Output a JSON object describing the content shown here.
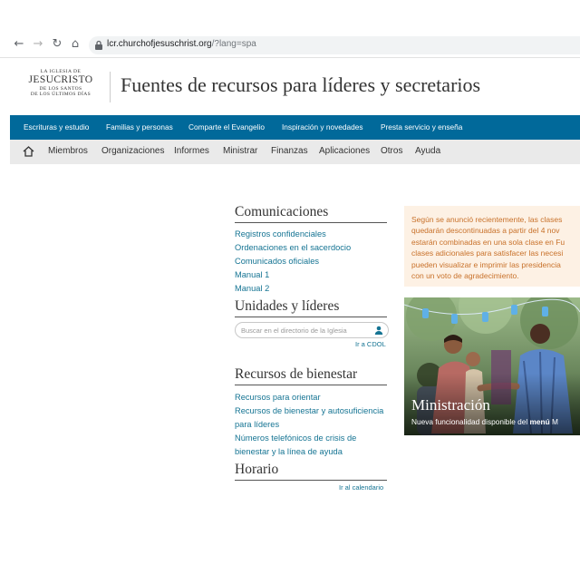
{
  "browser": {
    "url_host": "lcr.churchofjesuschrist.org",
    "url_path": "/?lang=spa"
  },
  "logo": {
    "line1": "LA IGLESIA DE",
    "line2": "JESUCRISTO",
    "line3": "DE LOS SANTOS",
    "line4": "DE LOS ÚLTIMOS DÍAS"
  },
  "header": {
    "title": "Fuentes de recursos para líderes y secretarios"
  },
  "primary_nav": [
    "Escrituras y estudio",
    "Familias y personas",
    "Comparte el Evangelio",
    "Inspiración y novedades",
    "Presta servicio y enseña"
  ],
  "secondary_nav": [
    "Miembros",
    "Organizaciones",
    "Informes",
    "Ministrar",
    "Finanzas",
    "Aplicaciones",
    "Otros",
    "Ayuda"
  ],
  "communications": {
    "title": "Comunicaciones",
    "links": [
      "Registros confidenciales",
      "Ordenaciones en el sacerdocio",
      "Comunicados oficiales",
      "Manual 1",
      "Manual 2"
    ]
  },
  "units": {
    "title": "Unidades y líderes",
    "search_placeholder": "Buscar en el directorio de la Iglesia",
    "cdol_link": "Ir a CDOL"
  },
  "welfare": {
    "title": "Recursos de bienestar",
    "links": [
      "Recursos para orientar",
      "Recursos de bienestar y autosuficiencia",
      "para líderes",
      "Números telefónicos de crisis de",
      "bienestar y la línea de ayuda"
    ]
  },
  "schedule": {
    "title": "Horario",
    "calendar_link": "Ir al calendario"
  },
  "notice": {
    "lines": [
      "Según se anunció recientemente, las clases",
      "quedarán descontinuadas a partir del 4 nov",
      "estarán combinadas en una sola clase en Fu",
      "clases adicionales para satisfacer las necesi",
      "pueden visualizar e imprimir las presidencia",
      "con un voto de agradecimiento."
    ]
  },
  "hero": {
    "title": "Ministración",
    "subtitle_prefix": "Nueva funcionalidad disponible del",
    "subtitle_bold": "menú",
    "subtitle_suffix": "M"
  },
  "colors": {
    "primary_nav_bg": "#01699a",
    "secondary_nav_bg": "#eaeaea",
    "link": "#157493",
    "notice_bg": "#fdf1e4",
    "notice_text": "#c8712a"
  }
}
